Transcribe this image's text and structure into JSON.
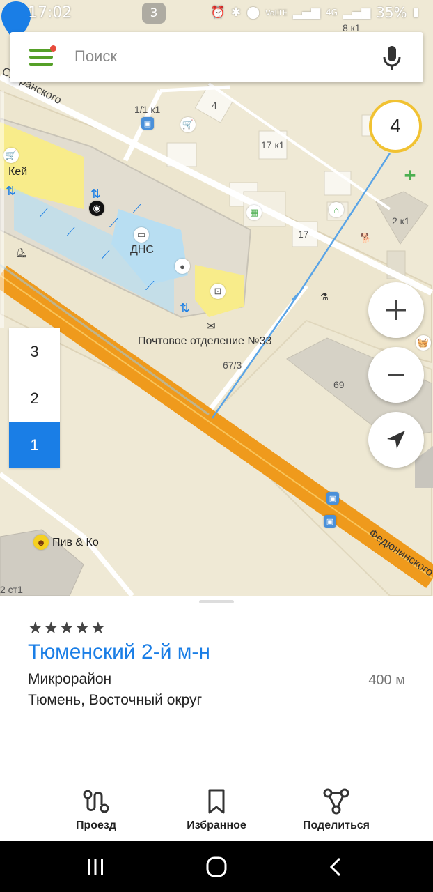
{
  "status_bar": {
    "time": "17:02",
    "notification_count": "3",
    "network": "4G",
    "battery": "35%"
  },
  "search": {
    "placeholder": "Поиск",
    "menu_icon": "hamburger-menu-icon",
    "mic_icon": "microphone-icon"
  },
  "map": {
    "zoom_level": "4",
    "labels": {
      "street_speranskogo": "Сперанского",
      "street_fedyuninskogo": "Федюнинского",
      "building_8k1": "8 к1",
      "building_1_1k1": "1/1 к1",
      "building_4": "4",
      "building_17k1": "17 к1",
      "building_17": "17",
      "building_2k1": "2 к1",
      "building_69": "69",
      "building_67_3": "67/3",
      "building_2st1": "2 ст1",
      "poi_key": "Кей",
      "poi_dns": "ДНС",
      "poi_post": "Почтовое отделение №33",
      "poi_piv": "Пив & Ко"
    },
    "floors": [
      "3",
      "2",
      "1"
    ],
    "active_floor": "1"
  },
  "controls": {
    "zoom_in": "+",
    "zoom_out": "−"
  },
  "place_card": {
    "rating_stars": "★★★★★",
    "title": "Тюменский 2-й м-н",
    "type": "Микрорайон",
    "address": "Тюмень, Восточный округ",
    "distance": "400 м"
  },
  "actions": {
    "route": "Проезд",
    "favorites": "Избранное",
    "share": "Поделиться"
  },
  "colors": {
    "accent_blue": "#1a7ee6",
    "menu_green": "#55a028",
    "road_orange": "#ef9a1c",
    "zoom_ring": "#f1c232"
  }
}
